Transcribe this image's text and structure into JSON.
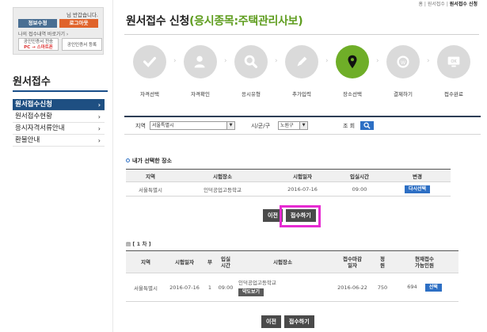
{
  "login": {
    "welcome_prefix": "",
    "welcome": "님 반갑습니다.",
    "info_button": "정보수정",
    "logout_button": "로그아웃",
    "history_link": "나의 접수내역 바로가기 ›",
    "cert_register_pc": "공인인증서 전송",
    "cert_register_tag": "PC → 스마트폰",
    "cert_register": "공인인증서 등록"
  },
  "sidebar": {
    "title": "원서접수",
    "items": [
      {
        "label": "원서접수신청",
        "active": true
      },
      {
        "label": "원서접수현황",
        "active": false
      },
      {
        "label": "응시자격서류안내",
        "active": false
      },
      {
        "label": "환불안내",
        "active": false
      }
    ]
  },
  "breadcrumb": {
    "home": "홈",
    "sep": " | ",
    "parent": "원서접수",
    "current": "원서접수 신청"
  },
  "page": {
    "title": "원서접수 신청",
    "subtitle": "(응시종목:주택관리사보)"
  },
  "steps": [
    {
      "label": "자격선택",
      "icon": "check-icon"
    },
    {
      "label": "자격확인",
      "icon": "person-icon"
    },
    {
      "label": "응시유형",
      "icon": "search-icon"
    },
    {
      "label": "추가입력",
      "icon": "pencil-icon"
    },
    {
      "label": "장소선택",
      "icon": "location-pin-icon",
      "active": true
    },
    {
      "label": "결제하기",
      "icon": "coin-icon"
    },
    {
      "label": "접수완료",
      "icon": "ok-monitor-icon"
    }
  ],
  "filter": {
    "region_label": "지역",
    "region_value": "서울특별시",
    "district_label": "시/군/구",
    "district_value": "노원구",
    "search_label": "조 회"
  },
  "selected": {
    "heading": "내가 선택한 장소",
    "columns": [
      "지역",
      "시험장소",
      "시험일자",
      "입실시간",
      "변경"
    ],
    "row": {
      "region": "서울특별시",
      "place": "인덕공업고등학교",
      "date": "2016-07-16",
      "time": "09:00",
      "action": "다시선택"
    }
  },
  "nav": {
    "prev": "이전",
    "submit": "접수하기"
  },
  "list": {
    "page_indicator": "[ 1 차 ]",
    "columns": [
      "지역",
      "시험일자",
      "부",
      "입실\n시간",
      "시험장소",
      "접수마감\n일자",
      "정\n원",
      "현재접수\n가능인원"
    ],
    "rows": [
      {
        "region": "서울특별시",
        "date": "2016-07-16",
        "part": "1",
        "time": "09:00",
        "place": "인덕공업고등학교",
        "map_button": "약도보기",
        "deadline": "2016-06-22",
        "capacity": "750",
        "available": "694",
        "action": "선택"
      }
    ]
  },
  "colors": {
    "accent_green": "#6fae28",
    "navy": "#1e4f82",
    "blue": "#2d6fc4",
    "highlight": "#e62bd2"
  }
}
